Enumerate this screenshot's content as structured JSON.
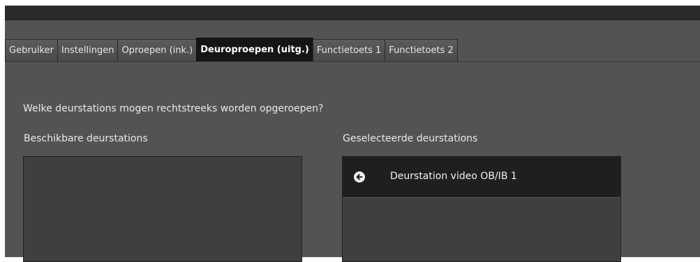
{
  "tabs": [
    {
      "label": "Gebruiker",
      "active": false
    },
    {
      "label": "Instellingen",
      "active": false
    },
    {
      "label": "Oproepen (ink.)",
      "active": false
    },
    {
      "label": "Deuroproepen (uitg.)",
      "active": true
    },
    {
      "label": "Functietoets 1",
      "active": false
    },
    {
      "label": "Functietoets 2",
      "active": false
    }
  ],
  "main": {
    "question": "Welke deurstations mogen rechtstreeks worden opgeroepen?",
    "available_label": "Beschikbare deurstations",
    "selected_label": "Geselecteerde deurstations",
    "available_items": [],
    "selected_items": [
      {
        "label": "Deurstation video OB/IB 1",
        "icon": "arrow-left-circle-icon"
      }
    ]
  },
  "colors": {
    "background": "#535353",
    "active_tab": "#151515",
    "list_bg": "#3f3f3f",
    "selected_item_bg": "#1f1f1f"
  }
}
